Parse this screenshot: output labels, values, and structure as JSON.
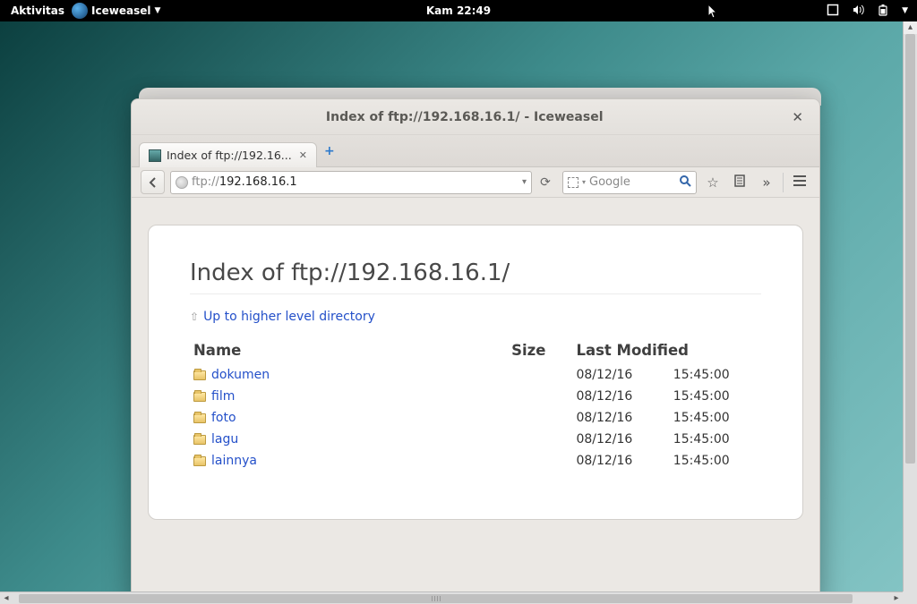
{
  "topbar": {
    "activities": "Aktivitas",
    "app_name": "Iceweasel",
    "clock": "Kam 22:49"
  },
  "window": {
    "title": "Index of ftp://192.168.16.1/ - Iceweasel",
    "tab_title": "Index of ftp://192.16...",
    "url_protocol": "ftp://",
    "url_host": "192.168.16.1",
    "search_placeholder": "Google"
  },
  "page": {
    "heading": "Index of ftp://192.168.16.1/",
    "up_link": "Up to higher level directory",
    "columns": {
      "name": "Name",
      "size": "Size",
      "modified": "Last Modified"
    },
    "entries": [
      {
        "name": "dokumen",
        "size": "",
        "date": "08/12/16",
        "time": "15:45:00"
      },
      {
        "name": "film",
        "size": "",
        "date": "08/12/16",
        "time": "15:45:00"
      },
      {
        "name": "foto",
        "size": "",
        "date": "08/12/16",
        "time": "15:45:00"
      },
      {
        "name": "lagu",
        "size": "",
        "date": "08/12/16",
        "time": "15:45:00"
      },
      {
        "name": "lainnya",
        "size": "",
        "date": "08/12/16",
        "time": "15:45:00"
      }
    ]
  }
}
